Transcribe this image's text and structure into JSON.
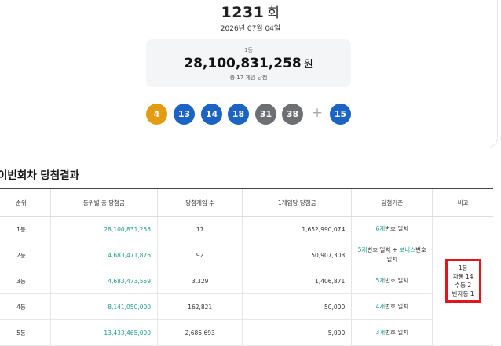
{
  "draw": {
    "round_number": "1231",
    "round_unit": "회",
    "date": "2026년 07월 04일"
  },
  "prize": {
    "rank": "1등",
    "amount": "28,100,831,258",
    "currency": "원",
    "games": "총 17 게임 당첨"
  },
  "balls": [
    {
      "number": "4",
      "color": "#e39b0f"
    },
    {
      "number": "13",
      "color": "#1c64c3"
    },
    {
      "number": "14",
      "color": "#1c64c3"
    },
    {
      "number": "18",
      "color": "#1c64c3"
    },
    {
      "number": "31",
      "color": "#6d6f73"
    },
    {
      "number": "38",
      "color": "#6d6f73"
    }
  ],
  "plus_symbol": "+",
  "bonus": {
    "number": "15",
    "color": "#1c64c3"
  },
  "section_title": "이번회차 당첨결과",
  "table": {
    "headers": [
      "순위",
      "등위별 총 당첨금",
      "당첨게임 수",
      "1게임당 당첨금",
      "당첨기준",
      "비고"
    ],
    "rows": [
      {
        "rank": "1등",
        "total": "28,100,831,258",
        "games": "17",
        "per_game": "1,652,990,074",
        "crit_count": "6개",
        "crit_text": "번호 일치"
      },
      {
        "rank": "2등",
        "total": "4,683,471,876",
        "games": "92",
        "per_game": "50,907,303",
        "crit_count": "5개",
        "crit_text": "번호 일치 + ",
        "crit_bonus": "보너스",
        "crit_tail": "번호",
        "crit_line2": "일치"
      },
      {
        "rank": "3등",
        "total": "4,683,473,559",
        "games": "3,329",
        "per_game": "1,406,871",
        "crit_count": "5개",
        "crit_text": "번호 일치"
      },
      {
        "rank": "4등",
        "total": "8,141,050,000",
        "games": "162,821",
        "per_game": "50,000",
        "crit_count": "4개",
        "crit_text": "번호 일치"
      },
      {
        "rank": "5등",
        "total": "13,433,465,000",
        "games": "2,686,693",
        "per_game": "5,000",
        "crit_count": "3개",
        "crit_text": "번호 일치"
      }
    ],
    "note": {
      "line1": "1등",
      "line2": "자동 14",
      "line3": "수동 2",
      "line4": "반자동 1"
    }
  }
}
